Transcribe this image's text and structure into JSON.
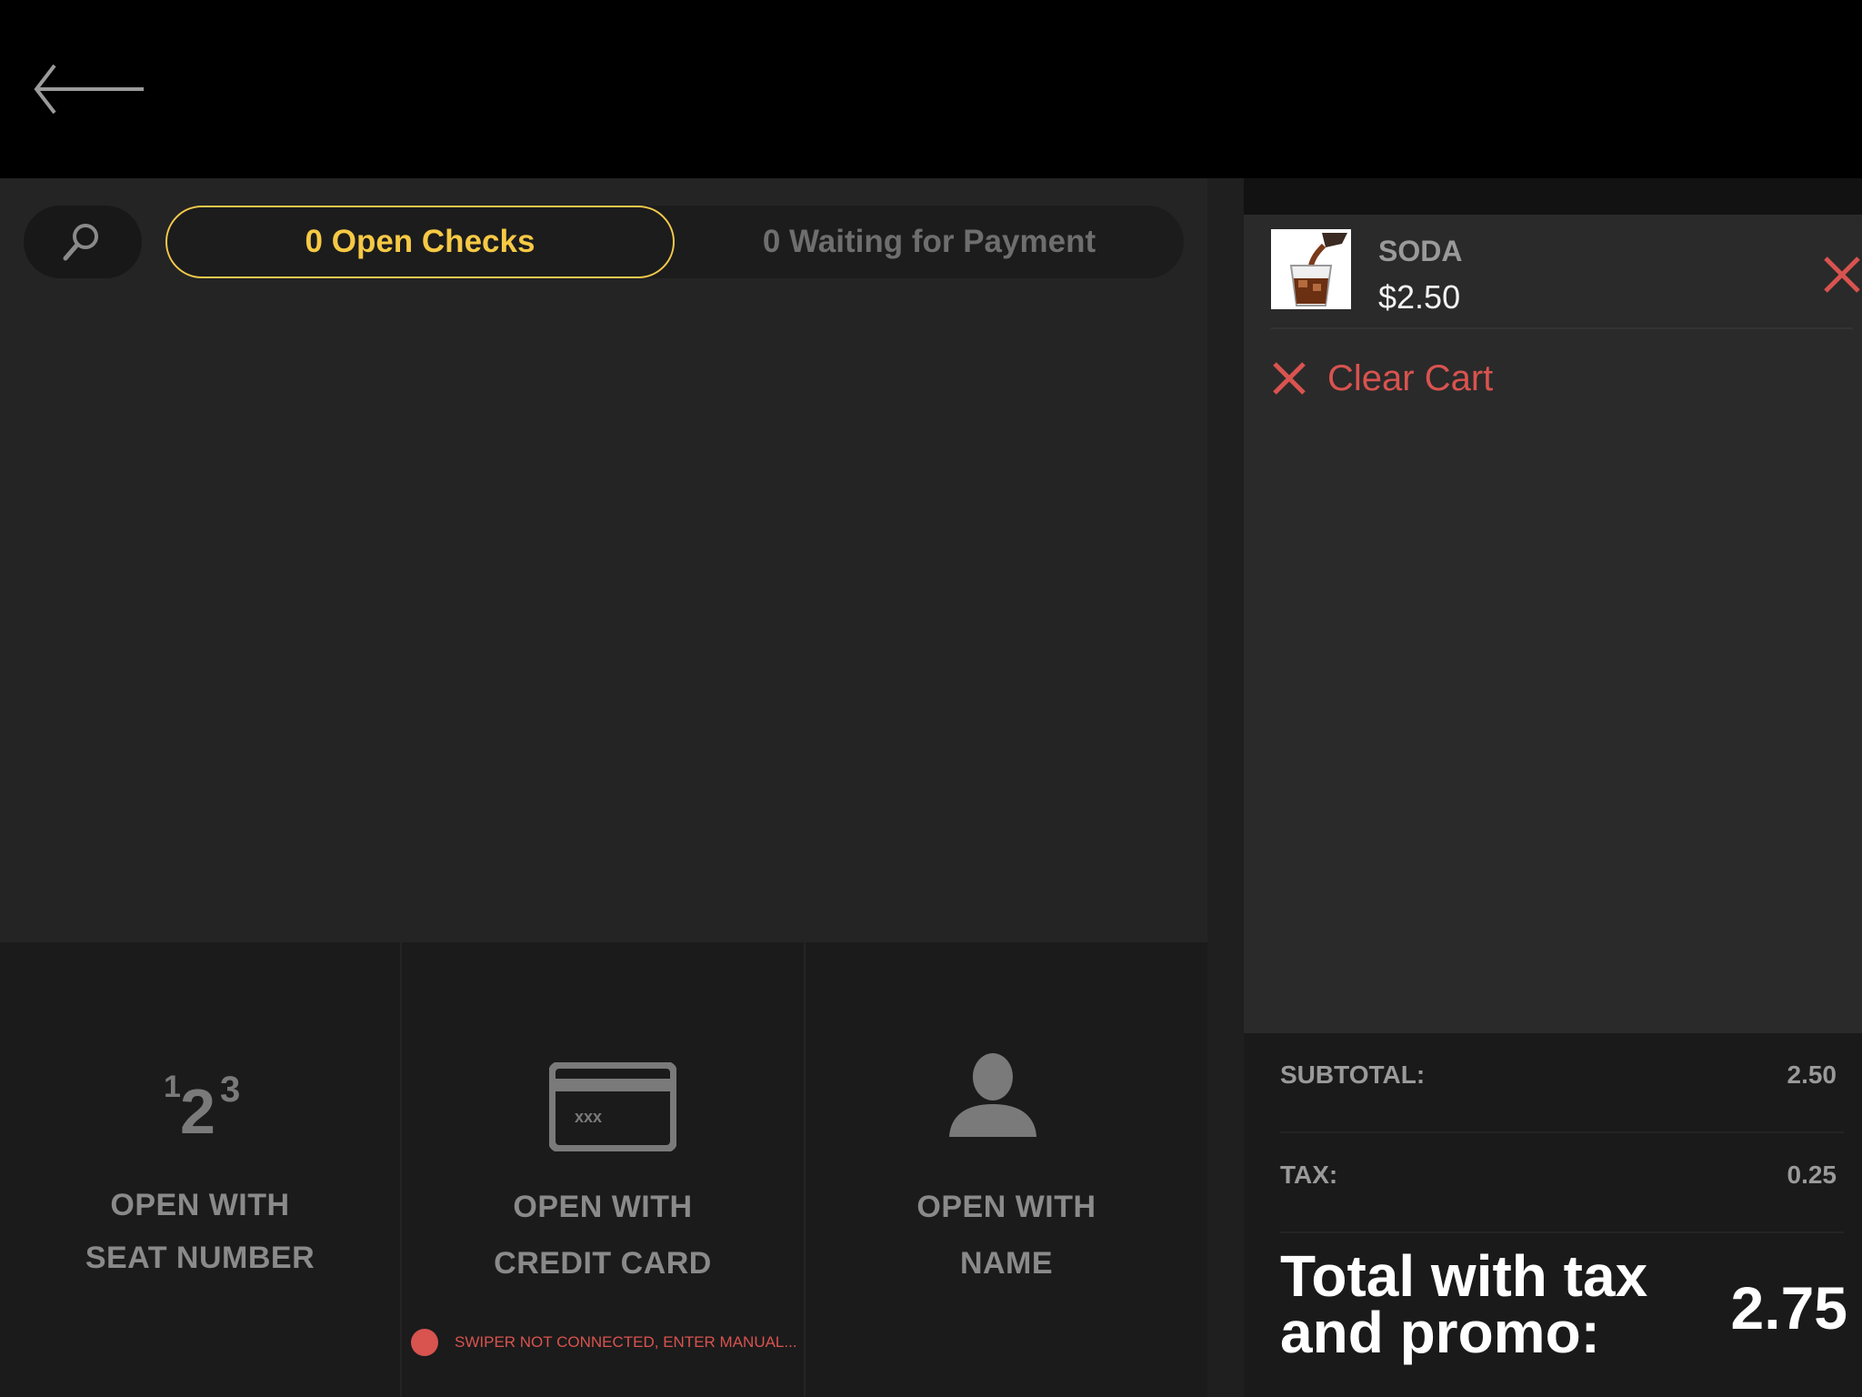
{
  "header": {
    "back_icon": "arrow-left-icon"
  },
  "search": {
    "icon": "search-icon"
  },
  "tabs": {
    "open_checks": "0 Open Checks",
    "waiting_for_payment": "0 Waiting for Payment"
  },
  "open_options": {
    "seat": {
      "line1": "OPEN WITH",
      "line2": "SEAT NUMBER",
      "icon": "seat-number-icon",
      "digit1": "1",
      "digit2": "2",
      "digit3": "3"
    },
    "card": {
      "line1": "OPEN WITH",
      "line2": "CREDIT CARD",
      "icon": "credit-card-icon",
      "card_mask": "xxx"
    },
    "name": {
      "line1": "OPEN WITH",
      "line2": "NAME",
      "icon": "person-icon"
    }
  },
  "swiper_warning": "SWIPER NOT CONNECTED, ENTER MANUAL...",
  "cart": {
    "items": [
      {
        "name": "SODA",
        "price": "$2.50"
      }
    ],
    "clear_label": "Clear Cart"
  },
  "totals": {
    "subtotal_label": "SUBTOTAL:",
    "subtotal_value": "2.50",
    "tax_label": "TAX:",
    "tax_value": "0.25",
    "grand_label": "Total with tax and promo:",
    "grand_value": "2.75"
  },
  "colors": {
    "accent": "#f6c945",
    "danger": "#d9534f",
    "panel": "#242424",
    "cart_bg": "#2a2a2a"
  }
}
